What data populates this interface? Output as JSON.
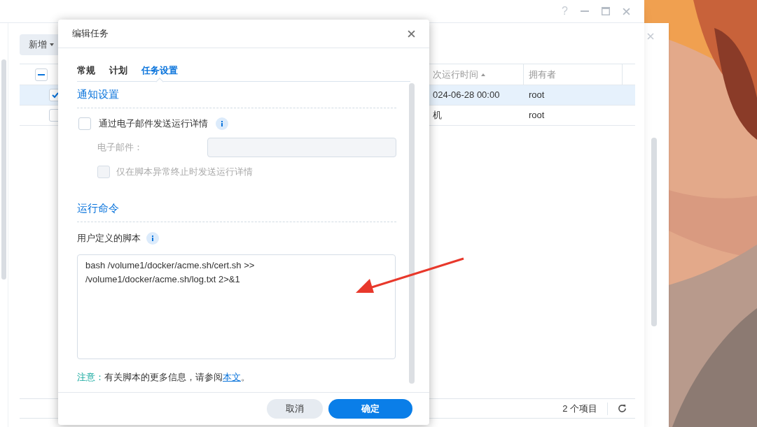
{
  "main_window": {
    "controls": [
      "?"
    ],
    "toolbar": {
      "new_button": "新增"
    },
    "table": {
      "header_checkbox": {
        "indeterminate": true
      },
      "columns": [
        "次运行时间",
        "拥有者"
      ],
      "sort_ascending": true,
      "rows": [
        {
          "selected": true,
          "checked": true,
          "cells": [
            "024-06-28 00:00",
            "root"
          ]
        },
        {
          "selected": false,
          "checked": false,
          "cells": [
            "机",
            "root"
          ]
        }
      ]
    },
    "footer": {
      "count": "2 个项目"
    }
  },
  "dialog": {
    "title": "编辑任务",
    "tabs": [
      {
        "label": "常规",
        "selected": false
      },
      {
        "label": "计划",
        "selected": false
      },
      {
        "label": "任务设置",
        "selected": true
      }
    ],
    "notify_section": {
      "heading": "通知设置",
      "email_checkbox": {
        "label": "通过电子邮件发送运行详情",
        "checked": false
      },
      "email_field": {
        "label": "电子邮件：",
        "disabled": true
      },
      "abnormal_checkbox": {
        "label": "仅在脚本异常终止时发送运行详情",
        "checked": false,
        "disabled": true
      }
    },
    "command_section": {
      "heading": "运行命令",
      "script_label": "用户定义的脚本",
      "script": "bash /volume1/docker/acme.sh/cert.sh >> /volume1/docker/acme.sh/log.txt 2>&1"
    },
    "note": {
      "prefix": "注意：",
      "text": "有关脚本的更多信息，请参阅",
      "link": "本文",
      "suffix": "。"
    },
    "buttons": {
      "cancel": "取消",
      "ok": "确定"
    }
  }
}
